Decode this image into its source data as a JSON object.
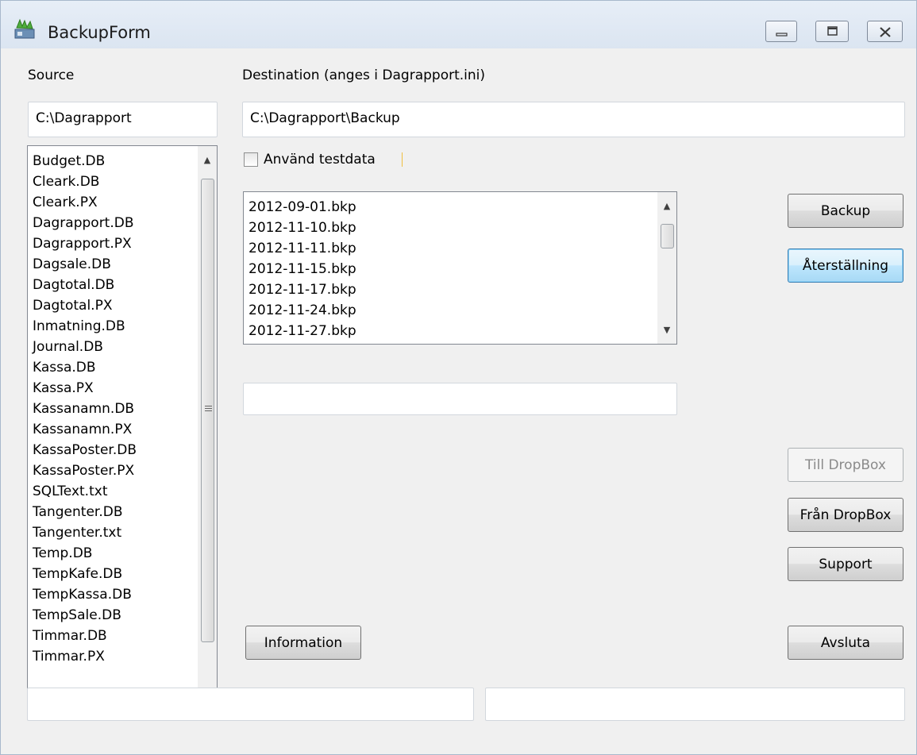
{
  "window": {
    "title": "BackupForm",
    "app_icon": "backup-app-icon",
    "caption_buttons": [
      "minimize-icon",
      "maximize-icon",
      "close-icon"
    ]
  },
  "source": {
    "label": "Source",
    "path": "C:\\Dagrapport",
    "files": [
      "Budget.DB",
      "Cleark.DB",
      "Cleark.PX",
      "Dagrapport.DB",
      "Dagrapport.PX",
      "Dagsale.DB",
      "Dagtotal.DB",
      "Dagtotal.PX",
      "Inmatning.DB",
      "Journal.DB",
      "Kassa.DB",
      "Kassa.PX",
      "Kassanamn.DB",
      "Kassanamn.PX",
      "KassaPoster.DB",
      "KassaPoster.PX",
      "SQLText.txt",
      "Tangenter.DB",
      "Tangenter.txt",
      "Temp.DB",
      "TempKafe.DB",
      "TempKassa.DB",
      "TempSale.DB",
      "Timmar.DB",
      "Timmar.PX"
    ]
  },
  "destination": {
    "label": "Destination (anges i Dagrapport.ini)",
    "path": "C:\\Dagrapport\\Backup",
    "testdata_label": "Använd testdata",
    "testdata_checked": false,
    "backups": [
      "2012-09-01.bkp",
      "2012-11-10.bkp",
      "2012-11-11.bkp",
      "2012-11-15.bkp",
      "2012-11-17.bkp",
      "2012-11-24.bkp",
      "2012-11-27.bkp"
    ],
    "status_text": ""
  },
  "buttons": {
    "backup": "Backup",
    "restore": "Återställning",
    "to_dropbox": "Till DropBox",
    "from_dropbox": "Från DropBox",
    "support": "Support",
    "information": "Information",
    "exit": "Avsluta"
  },
  "statusbar": {
    "left": "",
    "right": ""
  }
}
